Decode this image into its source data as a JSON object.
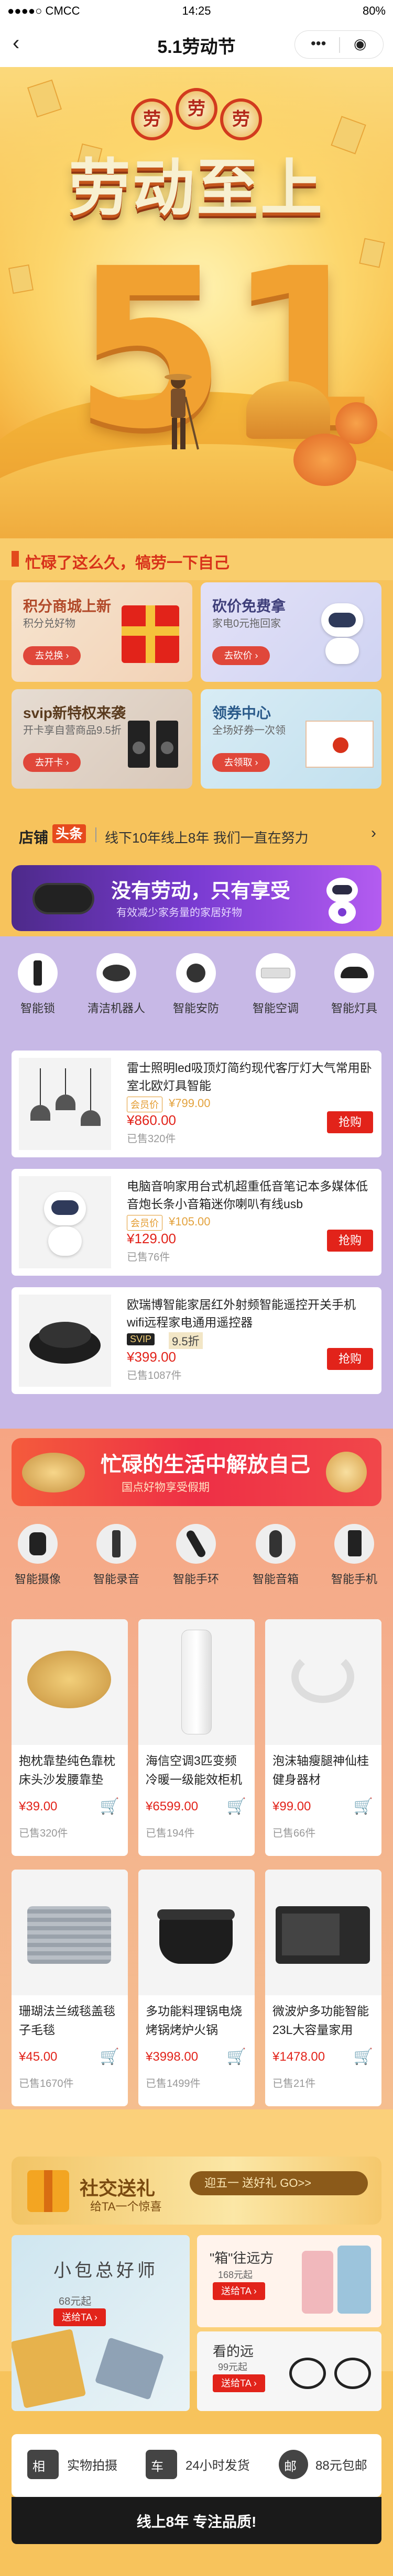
{
  "status_bar": {
    "carrier": "●●●●○ CMCC",
    "time": "14:25",
    "battery": "80%"
  },
  "nav": {
    "title": "5.1劳动节",
    "back": "‹",
    "more": "•••",
    "close": "◉"
  },
  "hero": {
    "title": "劳动至上",
    "number": "51",
    "medal_text": "劳"
  },
  "slogan": "忙碌了这么久，犒劳一下自己",
  "promos": [
    {
      "title": "积分商城上新",
      "subtitle": "积分兑好物",
      "button": "去兑换 ›"
    },
    {
      "title": "砍价免费拿",
      "subtitle": "家电0元拖回家",
      "button": "去砍价 ›"
    },
    {
      "title": "svip新特权来袭",
      "subtitle": "开卡享自营商品9.5折",
      "button": "去开卡 ›"
    },
    {
      "title": "领券中心",
      "subtitle": "全场好券一次领",
      "button": "去领取 ›"
    }
  ],
  "ticker": {
    "logo1": "店铺",
    "logo2": "头条",
    "text": "线下10年线上8年 我们一直在努力",
    "arrow": "›"
  },
  "purple_banner": {
    "title": "没有劳动，只有享受",
    "subtitle": "有效减少家务量的家居好物"
  },
  "smart_categories": [
    "智能锁",
    "清洁机器人",
    "智能安防",
    "智能空调",
    "智能灯具"
  ],
  "products": [
    {
      "name": "雷士照明led吸顶灯简约现代客厅灯大气常用卧室北欧灯具智能",
      "vip_label": "会员价",
      "vip_price": "¥799.00",
      "price": "¥860.00",
      "sold": "已售320件",
      "buy": "抢购"
    },
    {
      "name": "电脑音响家用台式机超重低音笔记本多媒体低音炮长条小音箱迷你喇叭有线usb",
      "vip_label": "会员价",
      "vip_price": "¥105.00",
      "price": "¥129.00",
      "sold": "已售76件",
      "buy": "抢购"
    },
    {
      "name": "欧瑞博智能家居红外射频智能遥控开关手机wifi远程家电通用遥控器",
      "vip_label": "SVIP",
      "vip_price": "9.5折",
      "price": "¥399.00",
      "sold": "已售1087件",
      "buy": "抢购"
    }
  ],
  "orange_banner": {
    "title": "忙碌的生活中解放自己",
    "subtitle": "国点好物享受假期"
  },
  "life_categories": [
    "智能摄像",
    "智能录音",
    "智能手环",
    "智能音箱",
    "智能手机"
  ],
  "grid_products": [
    {
      "name": "抱枕靠垫纯色靠枕床头沙发腰靠垫",
      "price": "¥39.00",
      "sold": "已售320件"
    },
    {
      "name": "海信空调3匹变频冷暖一级能效柜机",
      "price": "¥6599.00",
      "sold": "已售194件"
    },
    {
      "name": "泡沫轴瘦腿神仙桂健身器材",
      "price": "¥99.00",
      "sold": "已售66件"
    },
    {
      "name": "珊瑚法兰绒毯盖毯子毛毯",
      "price": "¥45.00",
      "sold": "已售1670件"
    },
    {
      "name": "多功能料理锅电烧烤锅烤炉火锅",
      "price": "¥3998.00",
      "sold": "已售1499件"
    },
    {
      "name": "微波炉多功能智能23L大容量家用",
      "price": "¥1478.00",
      "sold": "已售21件"
    }
  ],
  "gift": {
    "title": "社交送礼",
    "subtitle": "给TA一个惊喜",
    "pill": "迎五一  送好礼   GO>>",
    "boxes": [
      {
        "title": "小包总好师",
        "price": "68元起",
        "button": "送给TA ›"
      },
      {
        "title": "\"箱\"往远方",
        "price": "168元起",
        "button": "送给TA ›"
      },
      {
        "title": "看的远",
        "price": "99元起",
        "button": "送给TA ›"
      }
    ]
  },
  "footer": {
    "items": [
      "实物拍摄",
      "24小时发货",
      "88元包邮"
    ],
    "icons": [
      "相",
      "车",
      "邮"
    ],
    "tagline": "线上8年 专注品质!"
  }
}
